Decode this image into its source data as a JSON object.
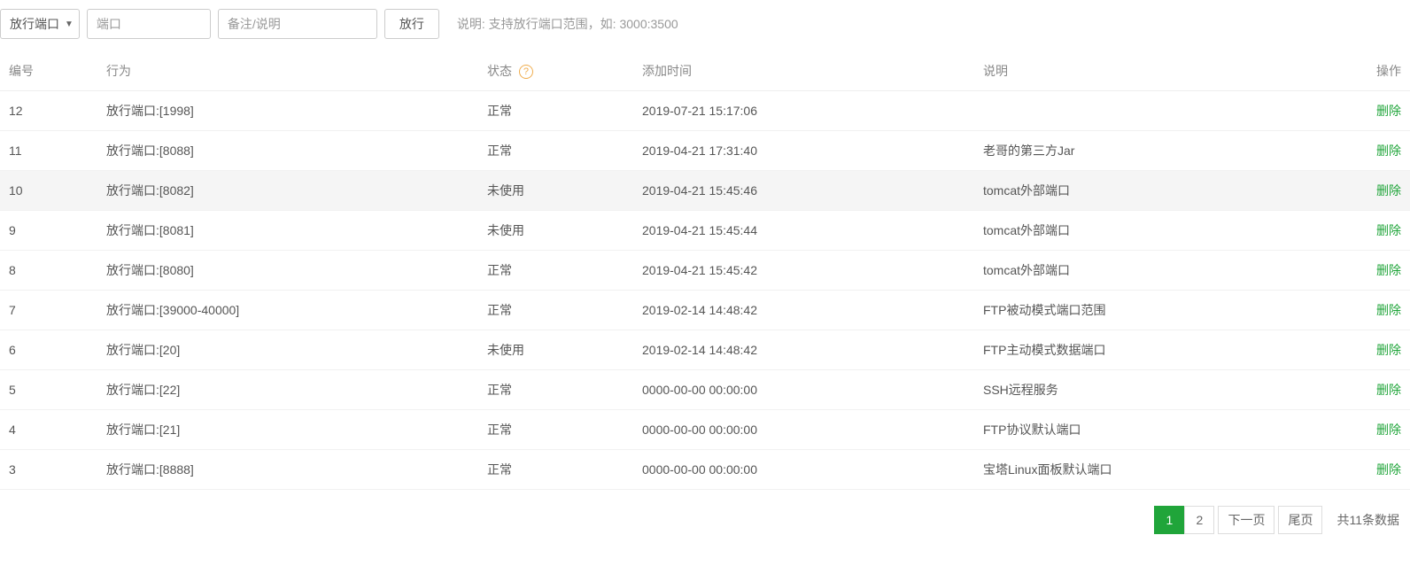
{
  "toolbar": {
    "select_label": "放行端口",
    "port_placeholder": "端口",
    "memo_placeholder": "备注/说明",
    "submit_label": "放行",
    "hint": "说明: 支持放行端口范围，如: 3000:3500"
  },
  "table": {
    "headers": {
      "id": "编号",
      "action": "行为",
      "status": "状态",
      "time": "添加时间",
      "desc": "说明",
      "op": "操作"
    },
    "delete_label": "删除",
    "rows": [
      {
        "id": "12",
        "action": "放行端口:[1998]",
        "status": "正常",
        "time": "2019-07-21 15:17:06",
        "desc": ""
      },
      {
        "id": "11",
        "action": "放行端口:[8088]",
        "status": "正常",
        "time": "2019-04-21 17:31:40",
        "desc": "老哥的第三方Jar"
      },
      {
        "id": "10",
        "action": "放行端口:[8082]",
        "status": "未使用",
        "time": "2019-04-21 15:45:46",
        "desc": "tomcat外部端口",
        "highlight": true
      },
      {
        "id": "9",
        "action": "放行端口:[8081]",
        "status": "未使用",
        "time": "2019-04-21 15:45:44",
        "desc": "tomcat外部端口"
      },
      {
        "id": "8",
        "action": "放行端口:[8080]",
        "status": "正常",
        "time": "2019-04-21 15:45:42",
        "desc": "tomcat外部端口"
      },
      {
        "id": "7",
        "action": "放行端口:[39000-40000]",
        "status": "正常",
        "time": "2019-02-14 14:48:42",
        "desc": "FTP被动模式端口范围"
      },
      {
        "id": "6",
        "action": "放行端口:[20]",
        "status": "未使用",
        "time": "2019-02-14 14:48:42",
        "desc": "FTP主动模式数据端口"
      },
      {
        "id": "5",
        "action": "放行端口:[22]",
        "status": "正常",
        "time": "0000-00-00 00:00:00",
        "desc": "SSH远程服务"
      },
      {
        "id": "4",
        "action": "放行端口:[21]",
        "status": "正常",
        "time": "0000-00-00 00:00:00",
        "desc": "FTP协议默认端口"
      },
      {
        "id": "3",
        "action": "放行端口:[8888]",
        "status": "正常",
        "time": "0000-00-00 00:00:00",
        "desc": "宝塔Linux面板默认端口"
      }
    ]
  },
  "pager": {
    "pages": [
      "1",
      "2"
    ],
    "active": "1",
    "next_label": "下一页",
    "last_label": "尾页",
    "total_label": "共11条数据"
  }
}
